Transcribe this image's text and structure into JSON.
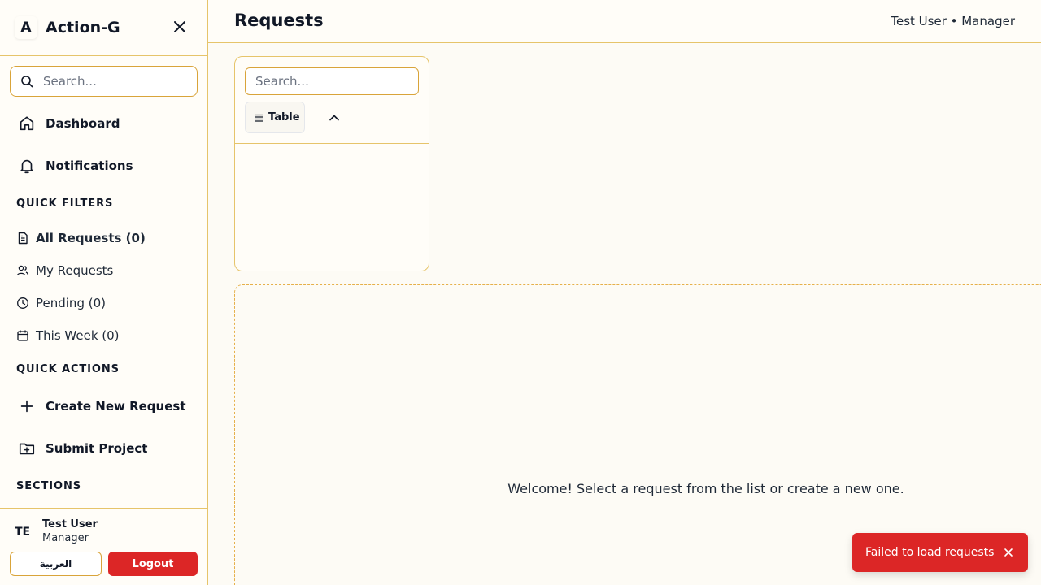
{
  "app": {
    "logo_letter": "A",
    "name": "Action-G"
  },
  "sidebar": {
    "search_placeholder": "Search...",
    "nav": [
      {
        "label": "Dashboard",
        "icon": "home-icon"
      },
      {
        "label": "Notifications",
        "icon": "bell-icon"
      }
    ],
    "quick_filters_title": "QUICK FILTERS",
    "filters": [
      {
        "label": "All Requests (0)",
        "icon": "document-icon"
      },
      {
        "label": "My Requests",
        "icon": "users-icon"
      },
      {
        "label": "Pending (0)",
        "icon": "clock-icon"
      },
      {
        "label": "This Week (0)",
        "icon": "calendar-icon"
      }
    ],
    "quick_actions_title": "QUICK ACTIONS",
    "actions": [
      {
        "label": "Create New Request",
        "icon": "plus-icon"
      },
      {
        "label": "Submit Project",
        "icon": "folder-plus-icon"
      }
    ],
    "sections_title": "SECTIONS",
    "user": {
      "initials": "TE",
      "name": "Test User",
      "role": "Manager"
    },
    "language_label": "العربية",
    "logout_label": "Logout"
  },
  "header": {
    "title": "Requests",
    "user_info": "Test User • Manager"
  },
  "list": {
    "search_placeholder": "Search...",
    "view_label": "Table"
  },
  "detail": {
    "welcome": "Welcome! Select a request from the list or create a new one."
  },
  "toast": {
    "message": "Failed to load requests"
  },
  "colors": {
    "accent_border": "#e6c46a",
    "danger": "#dc2626",
    "background": "#fdfbf5"
  }
}
